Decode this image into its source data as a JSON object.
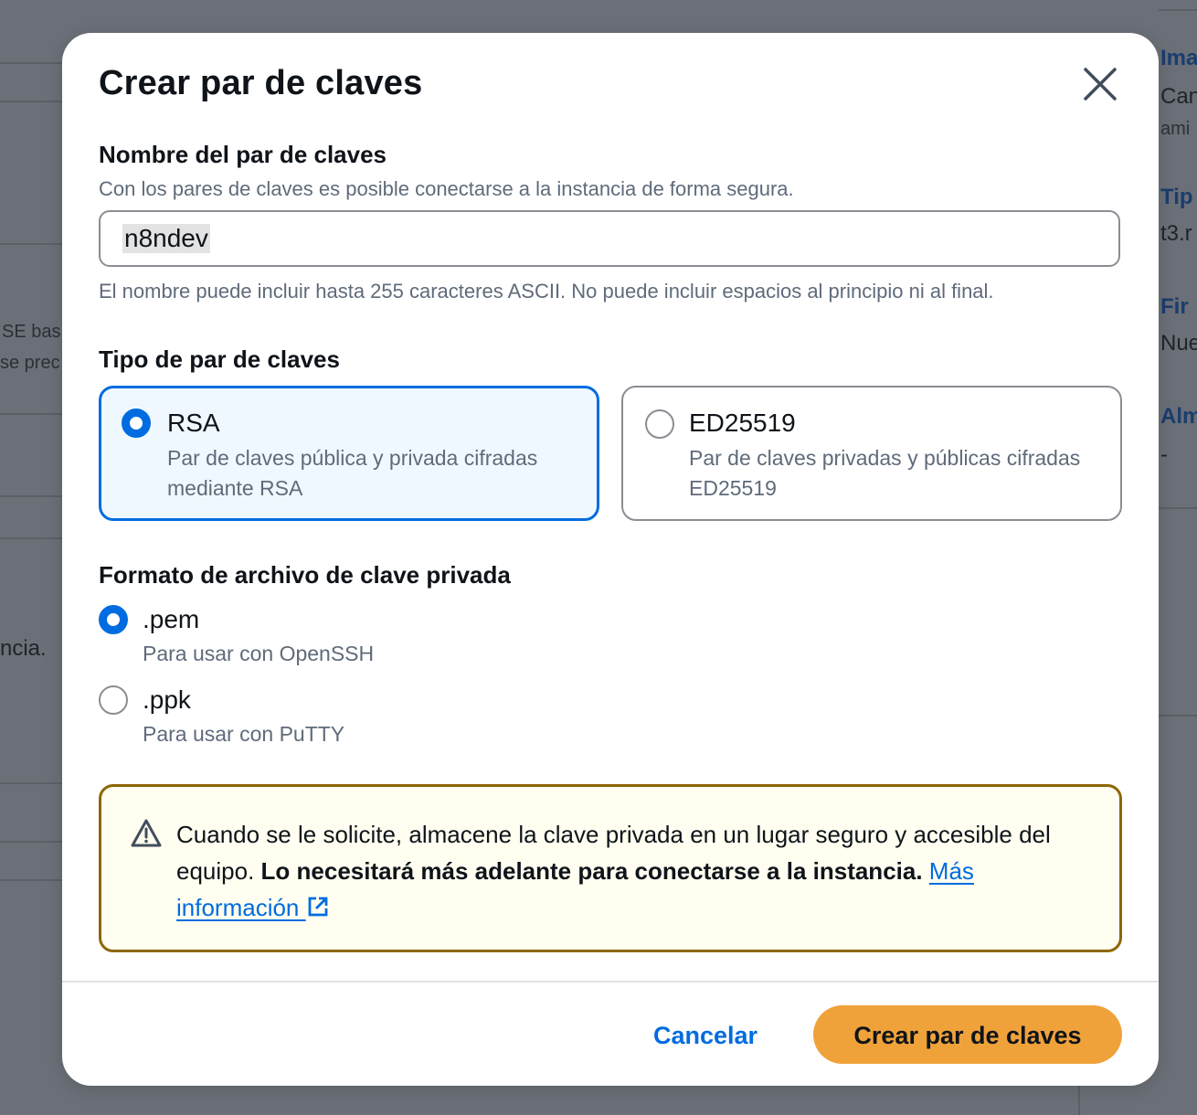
{
  "background": {
    "right_items": [
      {
        "title": "Ima",
        "value": "Can",
        "sub": "ami"
      },
      {
        "title": "Tip",
        "value": "t3.r"
      },
      {
        "title": "Fir",
        "value": "Nue"
      },
      {
        "title": "Alm",
        "value": "-"
      }
    ],
    "left_fragments": [
      "SE bas",
      "se prec",
      "ncia."
    ]
  },
  "modal": {
    "title": "Crear par de claves",
    "name_section": {
      "label": "Nombre del par de claves",
      "description": "Con los pares de claves es posible conectarse a la instancia de forma segura.",
      "value": "n8ndev",
      "constraint": "El nombre puede incluir hasta 255 caracteres ASCII. No puede incluir espacios al principio ni al final."
    },
    "type_section": {
      "label": "Tipo de par de claves",
      "options": [
        {
          "title": "RSA",
          "description": "Par de claves pública y privada cifradas mediante RSA",
          "selected": true
        },
        {
          "title": "ED25519",
          "description": "Par de claves privadas y públicas cifradas ED25519",
          "selected": false
        }
      ]
    },
    "format_section": {
      "label": "Formato de archivo de clave privada",
      "options": [
        {
          "title": ".pem",
          "description": "Para usar con OpenSSH",
          "selected": true
        },
        {
          "title": ".ppk",
          "description": "Para usar con PuTTY",
          "selected": false
        }
      ]
    },
    "alert": {
      "icon": "warning-icon",
      "text_plain": "Cuando se le solicite, almacene la clave privada en un lugar seguro y accesible del equipo.",
      "text_bold": "Lo necesitará más adelante para conectarse a la instancia.",
      "link_text": "Más información",
      "link_icon": "external-link-icon"
    },
    "footer": {
      "cancel_label": "Cancelar",
      "create_label": "Crear par de claves"
    }
  },
  "colors": {
    "accent": "#006ce0",
    "primary_button": "#f0a23a",
    "warning_border": "#8d6605",
    "warning_bg": "#fffef0",
    "selected_tile_bg": "#f0f8ff"
  }
}
